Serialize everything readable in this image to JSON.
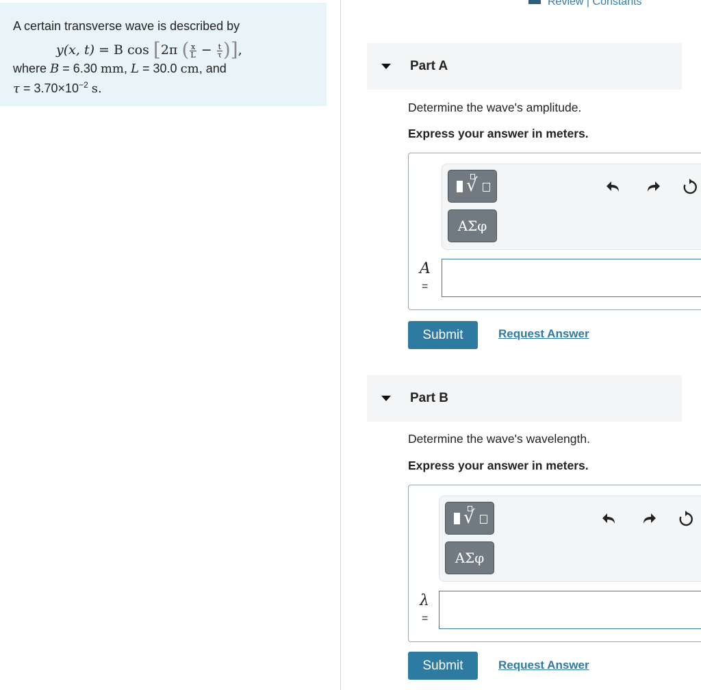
{
  "header": {
    "review_link": "Review | Constants"
  },
  "problem": {
    "intro": "A certain transverse wave is described by",
    "equation": {
      "lhs": "y(x, t)",
      "equals": "=",
      "rhs_prefix": "B cos",
      "two_pi": "2π",
      "frac1_num": "x",
      "frac1_den": "L",
      "minus": "−",
      "frac2_num": "t",
      "frac2_den": "τ",
      "tail": ","
    },
    "where": {
      "word": "where",
      "B_sym": "B",
      "B_val": "= 6.30",
      "B_unit": "mm",
      "L_sym": "L",
      "L_val": "= 30.0",
      "L_unit": "cm",
      "and": ", and",
      "tau_sym": "τ",
      "tau_val": "= 3.70×10",
      "tau_exp": "−2",
      "tau_unit": "s."
    }
  },
  "parts": [
    {
      "title": "Part A",
      "question": "Determine the wave's amplitude.",
      "instruction": "Express your answer in meters.",
      "variable": "A",
      "equals": "=",
      "input_value": "",
      "greek_button": "ΑΣφ",
      "submit_label": "Submit",
      "request_label": "Request Answer"
    },
    {
      "title": "Part B",
      "question": "Determine the wave's wavelength.",
      "instruction": "Express your answer in meters.",
      "variable": "λ",
      "equals": "=",
      "input_value": "",
      "greek_button": "ΑΣφ",
      "submit_label": "Submit",
      "request_label": "Request Answer"
    }
  ],
  "icons": {
    "collapse": "triangle-down-icon",
    "templates": "templates-radical-icon",
    "undo": "undo-icon",
    "redo": "redo-icon",
    "reset": "reset-icon",
    "review": "book-icon"
  },
  "colors": {
    "accent": "#2f7aa1",
    "problem_bg": "#e8f4f8"
  }
}
